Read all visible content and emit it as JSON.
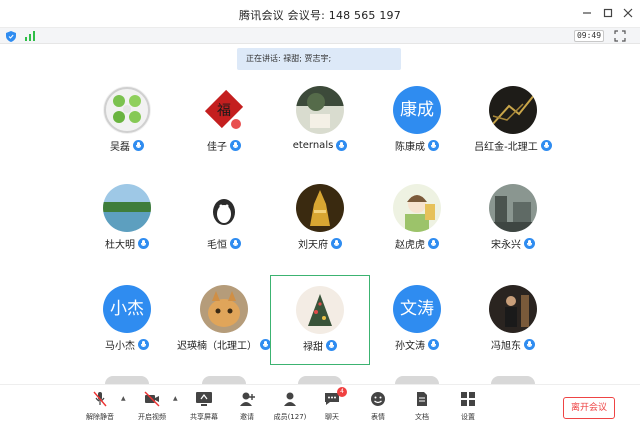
{
  "window": {
    "title": "腾讯会议  会议号: 148 565 197"
  },
  "status": {
    "time": "09:49"
  },
  "speaking_banner": "正在讲话: 禄甜; 贾志宇;",
  "participants": [
    {
      "name": "吴磊",
      "avatar_text": ""
    },
    {
      "name": "佳子",
      "avatar_text": ""
    },
    {
      "name": "eternals",
      "avatar_text": ""
    },
    {
      "name": "陈康成",
      "avatar_text": "康成"
    },
    {
      "name": "吕红金-北理工",
      "avatar_text": ""
    },
    {
      "name": "杜大明",
      "avatar_text": ""
    },
    {
      "name": "毛恒",
      "avatar_text": ""
    },
    {
      "name": "刘天府",
      "avatar_text": ""
    },
    {
      "name": "赵虎虎",
      "avatar_text": ""
    },
    {
      "name": "宋永兴",
      "avatar_text": ""
    },
    {
      "name": "马小杰",
      "avatar_text": "小杰"
    },
    {
      "name": "迟瑛楠（北理工）",
      "avatar_text": ""
    },
    {
      "name": "禄甜",
      "avatar_text": ""
    },
    {
      "name": "孙文涛",
      "avatar_text": "文涛"
    },
    {
      "name": "冯旭东",
      "avatar_text": ""
    }
  ],
  "toolbar": {
    "unmute": "解除静音",
    "video": "开启视频",
    "share": "共享屏幕",
    "invite": "邀请",
    "members": "成员(127)",
    "chat": "聊天",
    "chat_badge": "4",
    "reactions": "表情",
    "docs": "文档",
    "settings": "设置",
    "leave": "离开会议"
  },
  "colors": {
    "accent": "#2f8cf0",
    "leave": "#ee4444",
    "selected_border": "#3cb371",
    "banner_bg": "#dde9f8"
  }
}
